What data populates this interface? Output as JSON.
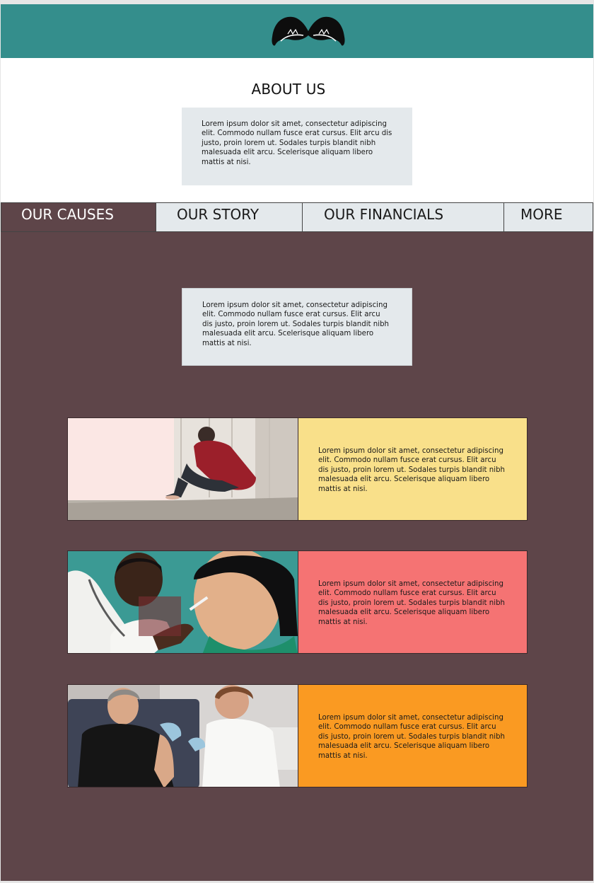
{
  "header": {
    "logo_icon": "mustache-icon",
    "background": "#348e8c"
  },
  "about": {
    "title": "ABOUT US",
    "text": "Lorem ipsum dolor sit amet, consectetur adipiscing elit. Commodo nullam fusce erat cursus. Elit arcu dis justo, proin lorem ut. Sodales turpis blandit nibh malesuada elit arcu. Scelerisque aliquam libero mattis at nisi."
  },
  "tabs": [
    {
      "label": "OUR CAUSES",
      "active": true
    },
    {
      "label": "OUR STORY",
      "active": false
    },
    {
      "label": "OUR FINANCIALS",
      "active": false
    },
    {
      "label": "MORE",
      "active": false
    }
  ],
  "causes": {
    "background": "#5e4549",
    "intro_text": "Lorem ipsum dolor sit amet, consectetur adipiscing elit. Commodo nullam fusce erat cursus. Elit arcu dis justo, proin lorem ut. Sodales turpis blandit nibh malesuada elit arcu. Scelerisque aliquam libero mattis at nisi.",
    "cards": [
      {
        "image": "sad-man-sitting-photo",
        "color": "#f9e08a",
        "text": "Lorem ipsum dolor sit amet, consectetur adipiscing elit. Commodo nullam fusce erat cursus. Elit arcu dis justo, proin lorem ut. Sodales turpis blandit nibh malesuada elit arcu. Scelerisque aliquam libero mattis at nisi."
      },
      {
        "image": "doctor-nasal-vaccine-photo",
        "color": "#f57373",
        "text": "Lorem ipsum dolor sit amet, consectetur adipiscing elit. Commodo nullam fusce erat cursus. Elit arcu dis justo, proin lorem ut. Sodales turpis blandit nibh malesuada elit arcu. Scelerisque aliquam libero mattis at nisi."
      },
      {
        "image": "nurse-arm-injection-photo",
        "color": "#fa9a22",
        "text": "Lorem ipsum dolor sit amet, consectetur adipiscing elit. Commodo nullam fusce erat cursus. Elit arcu dis justo, proin lorem ut. Sodales turpis blandit nibh malesuada elit arcu. Scelerisque aliquam libero mattis at nisi."
      }
    ]
  }
}
